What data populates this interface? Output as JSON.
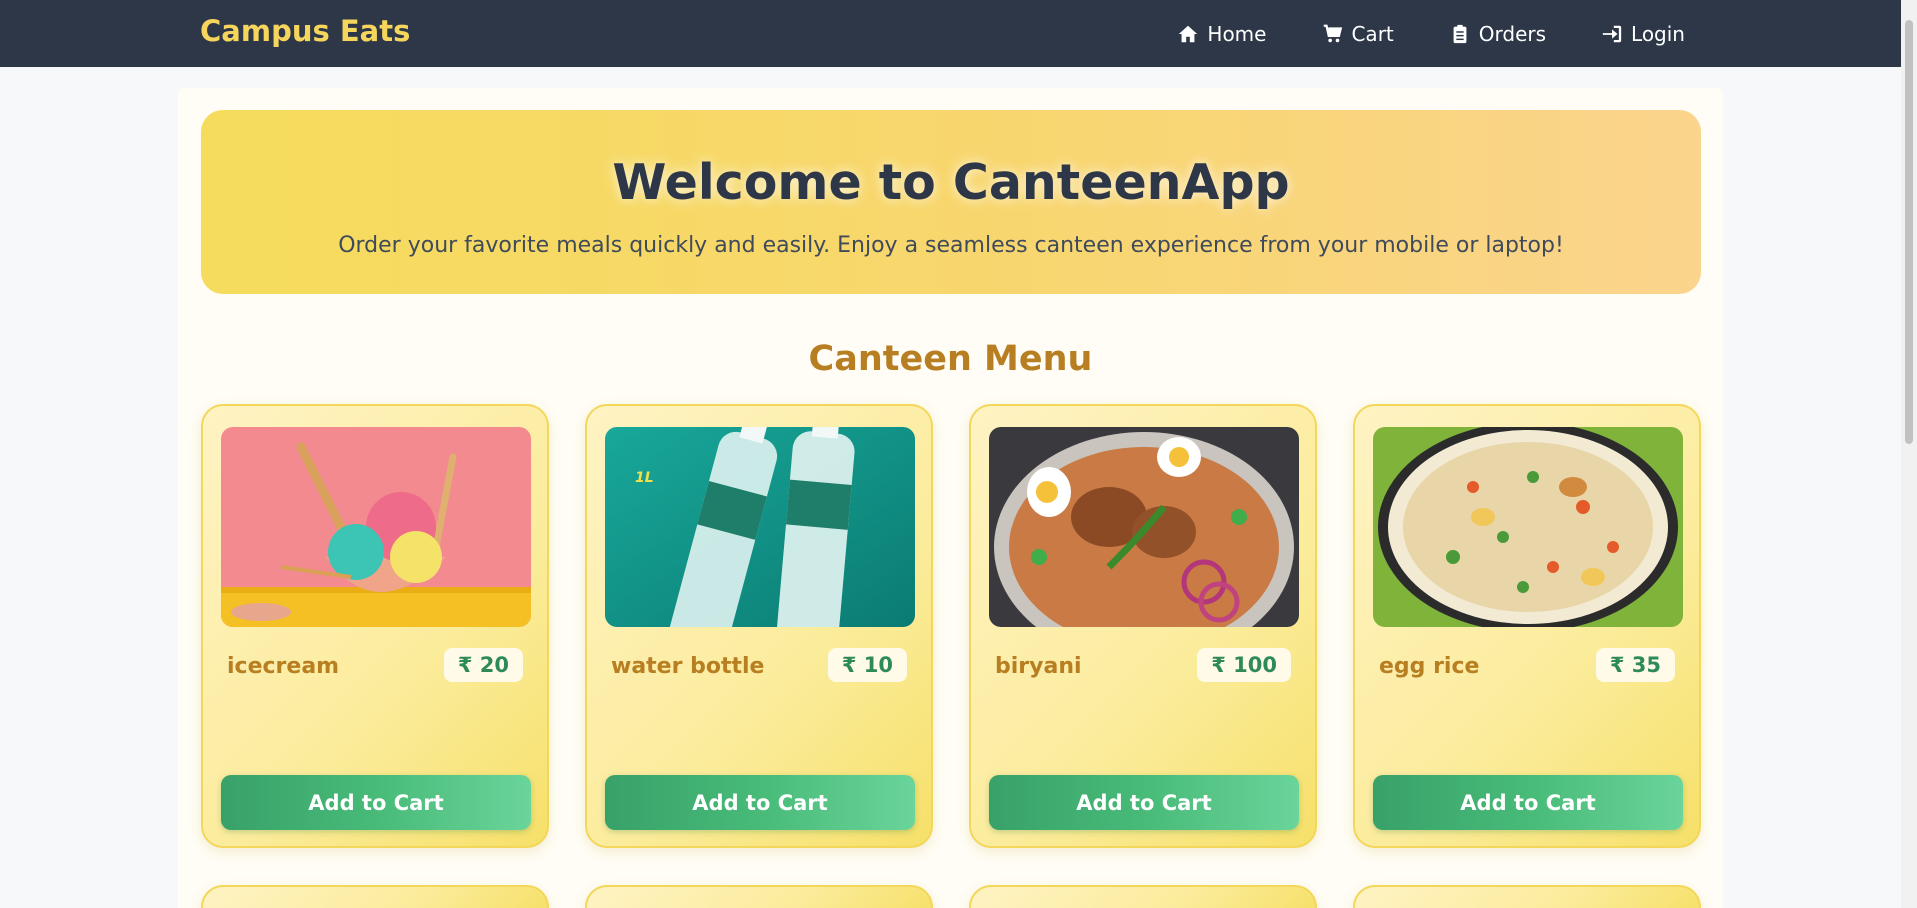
{
  "nav": {
    "brand": "Campus Eats",
    "links": [
      {
        "label": "Home",
        "icon": "home-icon"
      },
      {
        "label": "Cart",
        "icon": "cart-icon"
      },
      {
        "label": "Orders",
        "icon": "clipboard-icon"
      },
      {
        "label": "Login",
        "icon": "login-icon"
      }
    ]
  },
  "hero": {
    "title": "Welcome to CanteenApp",
    "subtitle": "Order your favorite meals quickly and easily. Enjoy a seamless canteen experience from your mobile or laptop!"
  },
  "menu": {
    "title": "Canteen Menu",
    "items": [
      {
        "name": "icecream",
        "price": "₹ 20",
        "button": "Add to Cart",
        "image": "icecream-image"
      },
      {
        "name": "water bottle",
        "price": "₹ 10",
        "button": "Add to Cart",
        "image": "water-bottle-image"
      },
      {
        "name": "biryani",
        "price": "₹ 100",
        "button": "Add to Cart",
        "image": "biryani-image"
      },
      {
        "name": "egg rice",
        "price": "₹ 35",
        "button": "Add to Cart",
        "image": "egg-rice-image"
      }
    ]
  },
  "colors": {
    "navbar": "#2d3748",
    "brand": "#f6d55c",
    "accent": "#b77f21",
    "price": "#2f8a5a",
    "button": "#48bb78"
  }
}
